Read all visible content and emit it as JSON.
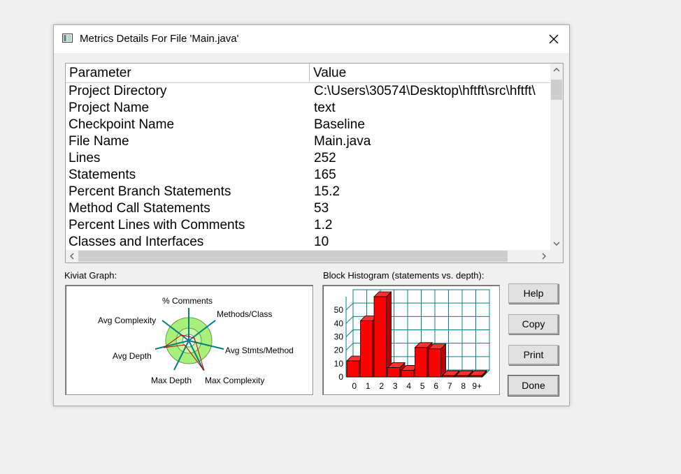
{
  "window": {
    "title": "Metrics Details For File 'Main.java'",
    "close_icon": "close-icon"
  },
  "table": {
    "headers": [
      "Parameter",
      "Value"
    ],
    "rows": [
      {
        "param": "Project Directory",
        "value": "C:\\Users\\30574\\Desktop\\hftft\\src\\hftft\\"
      },
      {
        "param": "Project Name",
        "value": "text"
      },
      {
        "param": "Checkpoint Name",
        "value": "Baseline"
      },
      {
        "param": "File Name",
        "value": "Main.java"
      },
      {
        "param": "Lines",
        "value": "252"
      },
      {
        "param": "Statements",
        "value": "165"
      },
      {
        "param": "Percent Branch Statements",
        "value": "15.2"
      },
      {
        "param": "Method Call Statements",
        "value": "53"
      },
      {
        "param": "Percent Lines with Comments",
        "value": "1.2"
      },
      {
        "param": "Classes and Interfaces",
        "value": "10"
      }
    ]
  },
  "kiviat": {
    "label": "Kiviat Graph:",
    "axes": [
      "% Comments",
      "Methods/Class",
      "Avg Stmts/Method",
      "Max Complexity",
      "Max Depth",
      "Avg Depth",
      "Avg Complexity"
    ],
    "colors": {
      "ring": "#a8f07a",
      "axis": "#008080",
      "data": "#c00000"
    }
  },
  "histogram": {
    "label": "Block Histogram (statements vs. depth):",
    "categories": [
      "0",
      "1",
      "2",
      "3",
      "4",
      "5",
      "6",
      "7",
      "8",
      "9+"
    ],
    "values": [
      12,
      42,
      60,
      7,
      5,
      22,
      21,
      1,
      1,
      1
    ],
    "yticks": [
      "0",
      "10",
      "20",
      "30",
      "40",
      "50"
    ],
    "ylim": [
      0,
      60
    ],
    "bar_color": "#ff0000",
    "grid_color": "#008080"
  },
  "buttons": {
    "help": "Help",
    "copy": "Copy",
    "print": "Print",
    "done": "Done"
  }
}
